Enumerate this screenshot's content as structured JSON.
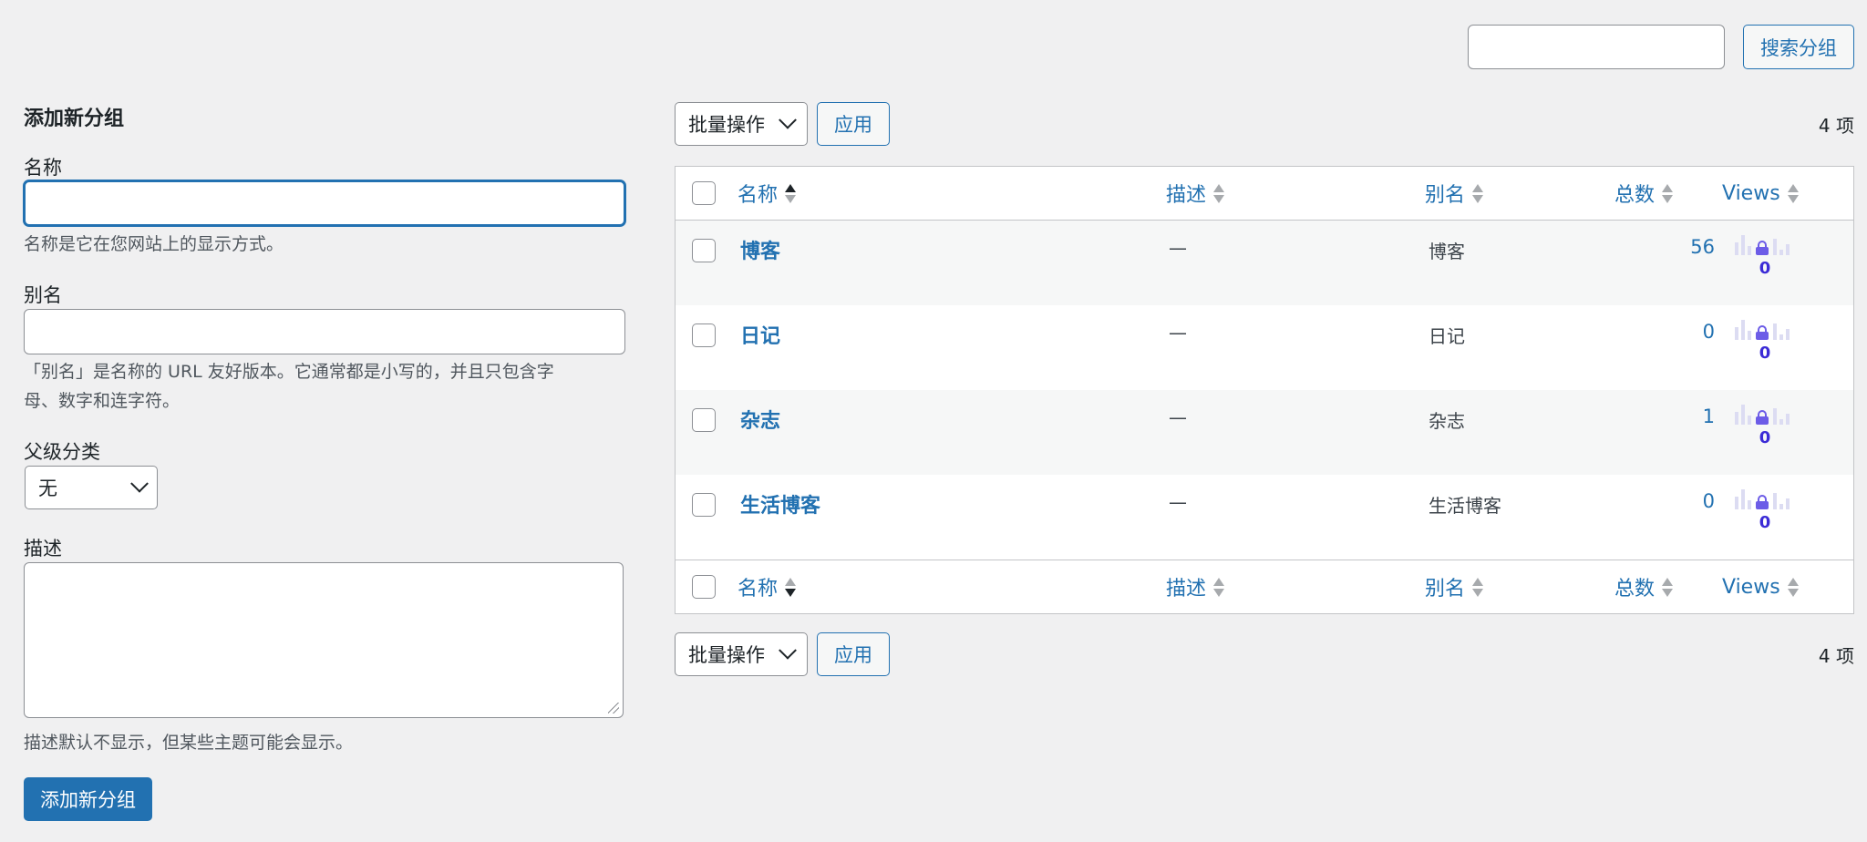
{
  "search": {
    "placeholder": "",
    "button_label": "搜索分组"
  },
  "form": {
    "title": "添加新分组",
    "name_label": "名称",
    "name_value": "",
    "name_help": "名称是它在您网站上的显示方式。",
    "slug_label": "别名",
    "slug_value": "",
    "slug_help_line1": "「别名」是名称的 URL 友好版本。它通常都是小写的，并且只包含字",
    "slug_help_line2": "母、数字和连字符。",
    "parent_label": "父级分类",
    "parent_selected": "无",
    "desc_label": "描述",
    "desc_help": "描述默认不显示，但某些主题可能会显示。",
    "submit_label": "添加新分组"
  },
  "tablenav": {
    "bulk_label": "批量操作",
    "apply_label": "应用",
    "count_label": "4 项"
  },
  "table": {
    "columns": {
      "name": "名称",
      "description": "描述",
      "slug": "别名",
      "count": "总数",
      "views": "Views"
    },
    "rows": [
      {
        "name": "博客",
        "description": "—",
        "slug": "博客",
        "count": "56",
        "views": "0"
      },
      {
        "name": "日记",
        "description": "—",
        "slug": "日记",
        "count": "0",
        "views": "0"
      },
      {
        "name": "杂志",
        "description": "—",
        "slug": "杂志",
        "count": "1",
        "views": "0"
      },
      {
        "name": "生活博客",
        "description": "—",
        "slug": "生活博客",
        "count": "0",
        "views": "0"
      }
    ]
  },
  "colors": {
    "accent": "#2271b1",
    "views_lock": "#6c5ce7",
    "views_number": "#3b2bd6",
    "background": "#f0f0f1"
  }
}
